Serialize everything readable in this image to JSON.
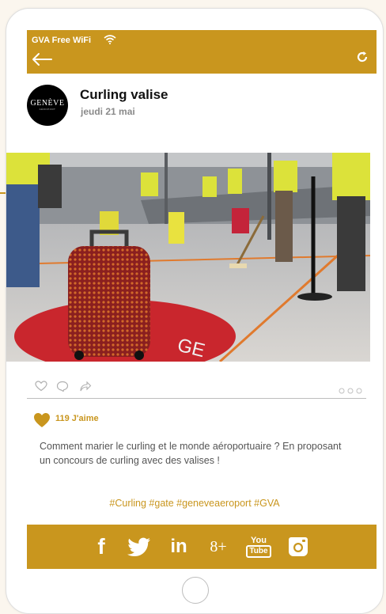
{
  "status_bar": {
    "network_label": "GVA Free WiFi",
    "wifi_icon": "wifi-icon",
    "back_icon": "arrow-left-icon",
    "refresh_icon": "refresh-icon"
  },
  "post": {
    "avatar": {
      "text": "GENÈVE",
      "subtext": "AÉROPORT"
    },
    "title": "Curling valise",
    "date": "jeudi 21 mai",
    "photo_alt": "Valise rouge sur cercle de curling dans le terminal",
    "actions": [
      "heart-outline-icon",
      "comment-icon",
      "share-icon"
    ],
    "more_icon": "more-dots-icon",
    "likes": "119 J'aime",
    "caption": "Comment marier le curling et le monde aéroportuaire ? En proposant un concours de curling avec des valises !",
    "hashtags": "#Curling #gate #geneveaeroport #GVA"
  },
  "social_bar": [
    {
      "name": "facebook-icon",
      "glyph": "f"
    },
    {
      "name": "twitter-icon",
      "glyph": ""
    },
    {
      "name": "linkedin-icon",
      "glyph": "in"
    },
    {
      "name": "googleplus-icon",
      "glyph": "8+"
    },
    {
      "name": "youtube-icon",
      "glyph_top": "You",
      "glyph_bottom": "Tube"
    },
    {
      "name": "instagram-icon",
      "glyph": ""
    }
  ],
  "colors": {
    "accent": "#c9961e",
    "background": "#fbf6ee",
    "text": "#111111",
    "muted": "#8a8a8a"
  }
}
